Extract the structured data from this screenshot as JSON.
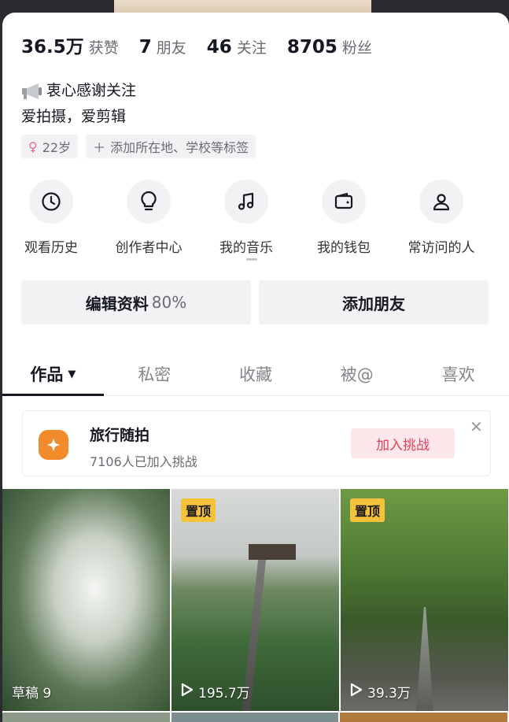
{
  "stats": [
    {
      "num": "36.5万",
      "label": "获赞"
    },
    {
      "num": "7",
      "label": "朋友"
    },
    {
      "num": "46",
      "label": "关注"
    },
    {
      "num": "8705",
      "label": "粉丝"
    }
  ],
  "bio": {
    "line1": "衷心感谢关注",
    "line2": "爱拍摄，爱剪辑",
    "icon": "megaphone-icon"
  },
  "tags": {
    "age": "22岁",
    "add_label": "添加所在地、学校等标签"
  },
  "shortcuts": [
    {
      "label": "观看历史",
      "icon": "clock-icon"
    },
    {
      "label": "创作者中心",
      "icon": "lightbulb-icon"
    },
    {
      "label": "我的音乐",
      "icon": "music-note-icon"
    },
    {
      "label": "我的钱包",
      "icon": "wallet-icon"
    },
    {
      "label": "常访问的人",
      "icon": "person-icon"
    }
  ],
  "actions": {
    "edit_label": "编辑资料",
    "edit_pct": "80%",
    "add_friend": "添加朋友"
  },
  "tabs": [
    {
      "label": "作品"
    },
    {
      "label": "私密"
    },
    {
      "label": "收藏"
    },
    {
      "label": "被@"
    },
    {
      "label": "喜欢"
    }
  ],
  "challenge": {
    "title": "旅行随拍",
    "subtitle": "7106人已加入挑战",
    "button": "加入挑战"
  },
  "videos": [
    {
      "caption": "草稿 9",
      "pinned": ""
    },
    {
      "caption": "195.7万",
      "pinned": "置顶"
    },
    {
      "caption": "39.3万",
      "pinned": "置顶"
    }
  ],
  "colors": {
    "accent_red": "#e5405c",
    "pin_yellow": "#f5c33b",
    "challenge_orange": "#f28b2c"
  }
}
